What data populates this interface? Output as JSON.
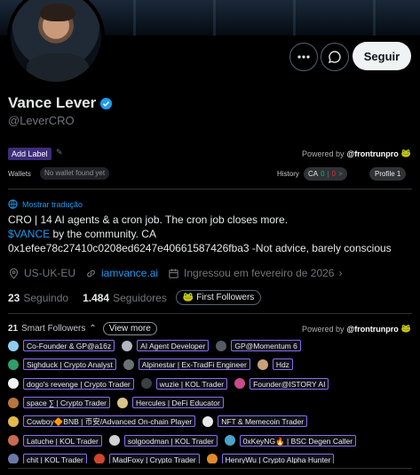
{
  "profile": {
    "name": "Vance Lever",
    "handle": "@LeverCRO",
    "follow_label": "Seguir"
  },
  "frontrun": {
    "add_label": "Add Label",
    "powered_by": "Powered by",
    "brand": "@frontrunpro",
    "wallets_label": "Wallets",
    "no_wallet": "No wallet found yet",
    "history_label": "History",
    "ca_label": "CA",
    "ca_green": "0",
    "ca_sep": "|",
    "ca_red": "0",
    "ca_arrow": ">",
    "profile_pill": "Profile 1"
  },
  "bio": {
    "translate": "Mostrar tradução",
    "line1": "CRO | 14 AI agents & a cron job. The cron job closes more.",
    "ticker": "$VANCE",
    "line2_rest": " by the community. CA",
    "line3": "0x1efee78c27410c0208ed6247e40661587426fba3 -Not advice, barely conscious"
  },
  "meta": {
    "location": "US-UK-EU",
    "website": "iamvance.ai",
    "joined": "Ingressou em fevereiro de 2026"
  },
  "counts": {
    "following_num": "23",
    "following_label": "Seguindo",
    "followers_num": "1.484",
    "followers_label": "Seguidores",
    "first_followers": "First Followers"
  },
  "smart_followers": {
    "count": "21",
    "label": "Smart Followers",
    "view_more": "View more",
    "powered_by": "Powered by",
    "brand": "@frontrunpro",
    "rows": [
      [
        {
          "label": "Co-Founder & GP@a16z",
          "color": "#8ecdf0"
        },
        {
          "label": "AI Agent Developer",
          "color": "#b0b8c0"
        },
        {
          "label": "GP@Momentum 6",
          "color": "#555b62"
        }
      ],
      [
        {
          "label": "Sighduck | Crypto Analyst",
          "color": "#2e9e6a"
        },
        {
          "label": "Alpinestar | Ex-TradFi Engineer",
          "color": "#6b7074"
        },
        {
          "label": "Hdz",
          "color": "#c9a27a"
        }
      ],
      [
        {
          "label": "dogo's revenge | Crypto Trader",
          "color": "#f2f2f2"
        },
        {
          "label": "wuzie | KOL Trader",
          "color": "#3a3f44"
        },
        {
          "label": "Founder@ISTORY AI",
          "color": "#c94a8a"
        }
      ],
      [
        {
          "label": "space ∑ | Crypto Trader",
          "color": "#b7763f"
        },
        {
          "label": "Hercules | DeFi Educator",
          "color": "#d8c48a"
        }
      ],
      [
        {
          "label": "Cowboy🔶BNB | 币安/Advanced On-chain Player",
          "color": "#e4b94c"
        },
        {
          "label": "NFT & Memecoin Trader",
          "color": "#e8e8e8"
        }
      ],
      [
        {
          "label": "Latuche | KOL Trader",
          "color": "#c96a52"
        },
        {
          "label": "solgoodman | KOL Trader",
          "color": "#d1d1d1"
        },
        {
          "label": "0xKeyNG🔥 | BSC Degen Caller",
          "color": "#4aa3c9"
        }
      ],
      [
        {
          "label": "chit | KOL Trader",
          "color": "#6a7aa8"
        },
        {
          "label": "MadFoxy | Crypto Trader",
          "color": "#d0452e"
        },
        {
          "label": "HenryWu | Crypto Alpha Hunter",
          "color": "#e08a2c"
        }
      ]
    ]
  },
  "icons": {
    "verified": "verified-badge-icon",
    "more": "more-icon",
    "message": "message-icon",
    "pencil": "pencil-icon",
    "frog": "frontrun-logo-icon",
    "translate": "translate-icon",
    "location": "location-icon",
    "link": "link-icon",
    "calendar": "calendar-icon"
  },
  "colors": {
    "accent": "#1d9bf0",
    "label_purple": "#3d2d7a",
    "tag_border": "#8a6cf0"
  }
}
